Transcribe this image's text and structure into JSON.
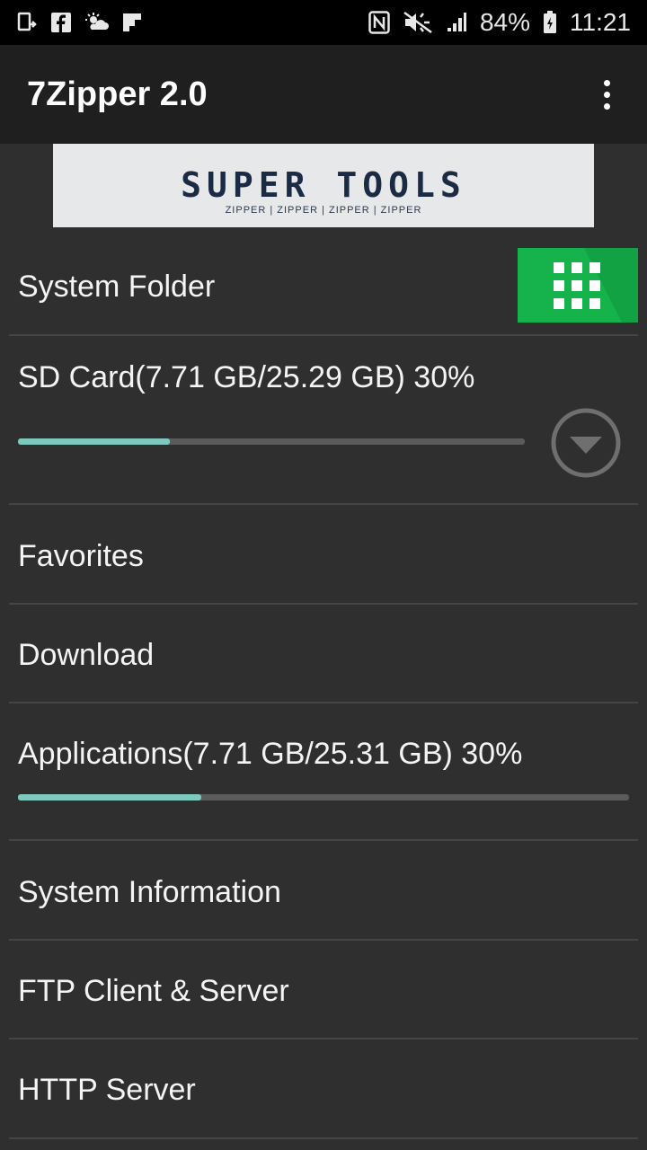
{
  "status_bar": {
    "icons_left": [
      "screen-mirror-icon",
      "facebook-icon",
      "weather-icon",
      "flipboard-icon"
    ],
    "icons_right": [
      "nfc-icon",
      "mute-icon",
      "signal-icon"
    ],
    "battery": "84%",
    "time": "11:21"
  },
  "app_bar": {
    "title": "7Zipper 2.0",
    "menu_icon": "more-vert-icon"
  },
  "banner": {
    "title": "SUPER TOOLS",
    "subtitle": "ZIPPER | ZIPPER | ZIPPER | ZIPPER"
  },
  "list": {
    "system_folder": "System Folder",
    "sd_card": {
      "label": "SD Card(7.71 GB/25.29 GB) 30%",
      "progress": 0.3
    },
    "favorites": "Favorites",
    "download": "Download",
    "applications": {
      "label": "Applications(7.71 GB/25.31 GB) 30%",
      "progress": 0.3
    },
    "system_information": "System Information",
    "ftp": "FTP Client & Server",
    "http": "HTTP Server"
  },
  "colors": {
    "accent_progress": "#7fc8bd",
    "grid_button": "#16b24c",
    "app_bar": "#1f1f1f",
    "background": "#2f2f2f"
  }
}
